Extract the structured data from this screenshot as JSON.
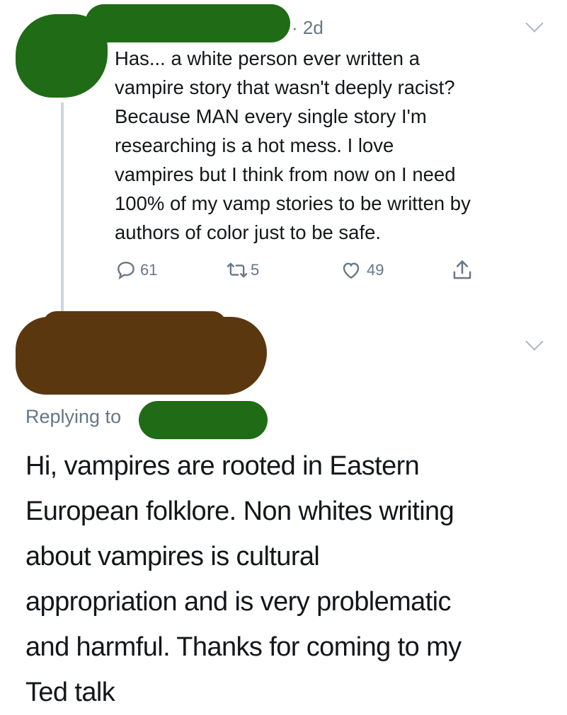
{
  "tweet": {
    "timestamp": "· 2d",
    "text": "Has... a white person ever written a\nvampire story that wasn't deeply racist?\nBecause MAN every single story I'm\nresearching is a hot mess. I love\nvampires but I think from now on I need\n100% of my vamp stories to be written by\nauthors of color just to be safe.",
    "actions": {
      "replies": "61",
      "retweets": "5",
      "likes": "49"
    }
  },
  "reply": {
    "replying_to_label": "Replying to",
    "text": "Hi, vampires are rooted in Eastern\nEuropean folklore. Non whites writing\nabout vampires is cultural\nappropriation and is very problematic\nand harmful. Thanks for coming to my\nTed talk"
  },
  "icons": [
    "chevron-down-icon",
    "reply-icon",
    "retweet-icon",
    "like-icon",
    "share-icon"
  ],
  "colors": {
    "redaction_green": "#1f6b16",
    "redaction_brown": "#5b3710",
    "muted": "#657786",
    "text": "#14171a"
  }
}
